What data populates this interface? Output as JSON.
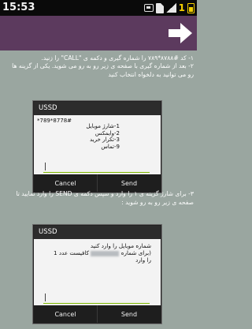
{
  "status_bar": {
    "time": "15:53",
    "sim_label": "1"
  },
  "header": {
    "back_icon": "arrow-right-icon"
  },
  "instructions": {
    "step1": "۱- کد #۸۷۸۸*۷۸۹ را شماره گیری و دکمه ی \"CALL\" را زنید.",
    "step2": "۲- بعد از شماره گیری با صفحه ی زیر رو به رو می شوید. یکی از گزینه ها رو می توانید به دلخواه انتخاب کنید",
    "step3": "۳- برای شارژ گزینه ی ۱ را وارد و سپس دکمه ی SEND را وارد نمایید تا صفحه ی زیر رو به رو شوید :"
  },
  "dialog1": {
    "title": "USSD",
    "number": "*789*8778#",
    "menu": [
      "1-شارژ موبایل",
      "2-وایمکس",
      "3-تکرار خرید",
      "9-تماس"
    ],
    "cancel": "Cancel",
    "send": "Send"
  },
  "dialog2": {
    "title": "USSD",
    "message_line1": "شماره موبایل را وارد کنید",
    "message_line2_a": "(برای شماره",
    "message_line2_b": "کافیست عدد 1",
    "message_line3": "را وارد",
    "cancel": "Cancel",
    "send": "Send"
  }
}
